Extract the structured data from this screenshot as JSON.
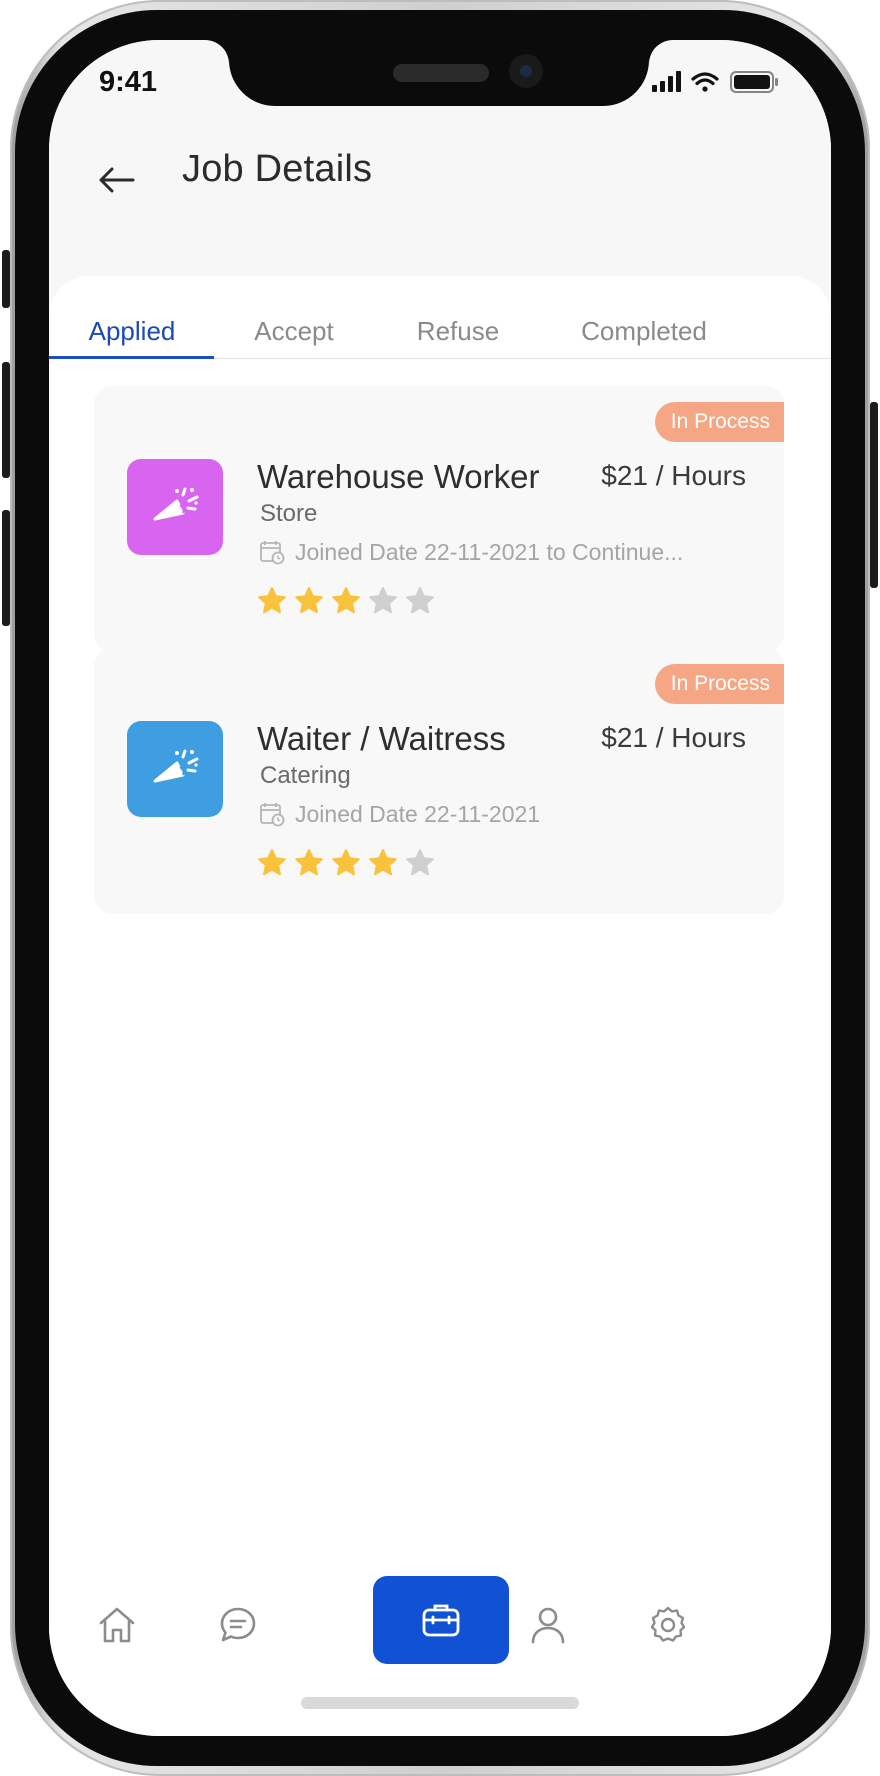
{
  "status_bar": {
    "time": "9:41"
  },
  "header": {
    "title": "Job Details"
  },
  "tabs": [
    {
      "label": "Applied",
      "active": true
    },
    {
      "label": "Accept",
      "active": false
    },
    {
      "label": "Refuse",
      "active": false
    },
    {
      "label": "Completed",
      "active": false
    }
  ],
  "jobs": [
    {
      "title": "Warehouse Worker",
      "rate": "$21 / Hours",
      "category": "Store",
      "joined": "Joined Date 22-11-2021  to Continue...",
      "status": "In Process",
      "rating": 3,
      "rating_max": 5,
      "icon": "party-popper-icon",
      "icon_color": "#d865ef"
    },
    {
      "title": "Waiter / Waitress",
      "rate": "$21 / Hours",
      "category": "Catering",
      "joined": "Joined Date 22-11-2021",
      "status": "In Process",
      "rating": 4,
      "rating_max": 5,
      "icon": "party-popper-icon",
      "icon_color": "#3e9ee1"
    }
  ],
  "bottom_nav": [
    {
      "icon": "home-icon",
      "active": false
    },
    {
      "icon": "chat-icon",
      "active": false
    },
    {
      "icon": "briefcase-icon",
      "active": true
    },
    {
      "icon": "user-icon",
      "active": false
    },
    {
      "icon": "gear-icon",
      "active": false
    }
  ],
  "colors": {
    "accent": "#1151d3",
    "tab_active": "#1b49b8",
    "badge": "#f5a785",
    "star_filled": "#f9c23c",
    "star_empty": "#cfcfcf"
  }
}
